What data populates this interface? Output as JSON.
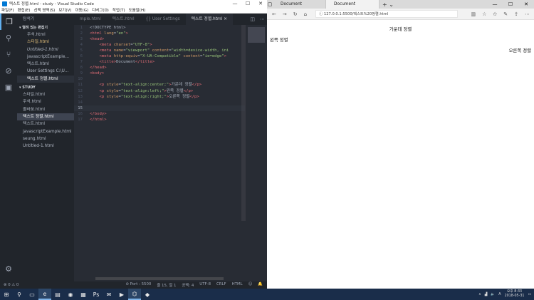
{
  "vscode": {
    "title": "텍스트 정렬.html - study - Visual Studio Code",
    "menu": [
      "파일(F)",
      "편집(E)",
      "선택 영역(S)",
      "보기(V)",
      "이동(G)",
      "디버그(D)",
      "작업(T)",
      "도움말(H)"
    ],
    "sidebar": {
      "title": "탐색기",
      "open_editors_title": "▾ 열려 있는 편집기",
      "open_editors": [
        "주석.html",
        "스타일.html",
        "Untitled-1.html",
        "javascriptExample...",
        "텍스트.html",
        "User Settings  C:\\U...",
        "텍스트 정렬.html"
      ],
      "folder_title": "▾ STUDY",
      "files": [
        "스타일.html",
        "주석.html",
        "줄바꿈.html",
        "텍스트 정렬.html",
        "텍스트.html",
        "javascriptExample.html",
        "seung.html",
        "Untitled-1.html"
      ]
    },
    "tabs": [
      "mple.html",
      "텍스트.html",
      "{} User Settings",
      "텍스트 정렬.html ×"
    ],
    "status": {
      "errors": "⊗ 0 ⚠ 0",
      "port": "⊘ Port : 5500",
      "position": "줄 15, 열 1",
      "spaces": "공백: 4",
      "encoding": "UTF-8",
      "eol": "CRLF",
      "language": "HTML",
      "smile": "☺",
      "bell": "🔔"
    }
  },
  "code": {
    "lines": [
      {
        "n": "1",
        "t": [
          [
            "p",
            "<!DOCTYPE html>"
          ]
        ]
      },
      {
        "n": "2",
        "t": [
          [
            "k",
            "<html "
          ],
          [
            "a",
            "lang"
          ],
          [
            "p",
            "="
          ],
          [
            "s",
            "\"en\""
          ],
          [
            "k",
            ">"
          ]
        ]
      },
      {
        "n": "3",
        "t": [
          [
            "k",
            "<head>"
          ]
        ]
      },
      {
        "n": "4",
        "t": [
          [
            "p",
            "    "
          ],
          [
            "k",
            "<meta "
          ],
          [
            "a",
            "charset"
          ],
          [
            "p",
            "="
          ],
          [
            "s",
            "\"UTF-8\""
          ],
          [
            "k",
            ">"
          ]
        ]
      },
      {
        "n": "5",
        "t": [
          [
            "p",
            "    "
          ],
          [
            "k",
            "<meta "
          ],
          [
            "a",
            "name"
          ],
          [
            "p",
            "="
          ],
          [
            "s",
            "\"viewport\" "
          ],
          [
            "a",
            "content"
          ],
          [
            "p",
            "="
          ],
          [
            "s",
            "\"width=device-width, ini"
          ]
        ]
      },
      {
        "n": "6",
        "t": [
          [
            "p",
            "    "
          ],
          [
            "k",
            "<meta "
          ],
          [
            "a",
            "http-equiv"
          ],
          [
            "p",
            "="
          ],
          [
            "s",
            "\"X-UA-Compatible\" "
          ],
          [
            "a",
            "content"
          ],
          [
            "p",
            "="
          ],
          [
            "s",
            "\"ie=edge\""
          ],
          [
            "k",
            ">"
          ]
        ]
      },
      {
        "n": "7",
        "t": [
          [
            "p",
            "    "
          ],
          [
            "k",
            "<title>"
          ],
          [
            "p",
            "Document"
          ],
          [
            "k",
            "</title>"
          ]
        ]
      },
      {
        "n": "8",
        "t": [
          [
            "k",
            "</head>"
          ]
        ]
      },
      {
        "n": "9",
        "t": [
          [
            "k",
            "<body>"
          ]
        ]
      },
      {
        "n": "10",
        "t": [
          [
            "p",
            ""
          ]
        ]
      },
      {
        "n": "11",
        "t": [
          [
            "p",
            "    "
          ],
          [
            "k",
            "<p "
          ],
          [
            "a",
            "style"
          ],
          [
            "p",
            "="
          ],
          [
            "s",
            "\"text-align:center;\""
          ],
          [
            "k",
            ">"
          ],
          [
            "p",
            "가운데 정렬"
          ],
          [
            "k",
            "</p>"
          ]
        ]
      },
      {
        "n": "12",
        "t": [
          [
            "p",
            "    "
          ],
          [
            "k",
            "<p "
          ],
          [
            "a",
            "style"
          ],
          [
            "p",
            "="
          ],
          [
            "s",
            "\"text-align:left;\""
          ],
          [
            "k",
            ">"
          ],
          [
            "p",
            "왼쪽 정렬"
          ],
          [
            "k",
            "</p>"
          ]
        ]
      },
      {
        "n": "13",
        "t": [
          [
            "p",
            "    "
          ],
          [
            "k",
            "<p "
          ],
          [
            "a",
            "style"
          ],
          [
            "p",
            "="
          ],
          [
            "s",
            "\"text-align:right;\""
          ],
          [
            "k",
            ">"
          ],
          [
            "p",
            "오른쪽 정렬"
          ],
          [
            "k",
            "</p>"
          ]
        ]
      },
      {
        "n": "14",
        "t": [
          [
            "p",
            ""
          ]
        ]
      },
      {
        "n": "15",
        "t": [
          [
            "p",
            ""
          ]
        ]
      },
      {
        "n": "16",
        "t": [
          [
            "k",
            "</body>"
          ]
        ]
      },
      {
        "n": "17",
        "t": [
          [
            "k",
            "</html>"
          ]
        ]
      }
    ]
  },
  "browser": {
    "tab1": "Document",
    "tab2": "Document",
    "url": "127.0.0.1:5500/텍스트%20정렬.html",
    "center_text": "가운데 정렬",
    "left_text": "왼쪽 정렬",
    "right_text": "오른쪽 정렬"
  },
  "taskbar": {
    "time": "오후 8:33",
    "date": "2018-05-31",
    "lang": "A"
  }
}
